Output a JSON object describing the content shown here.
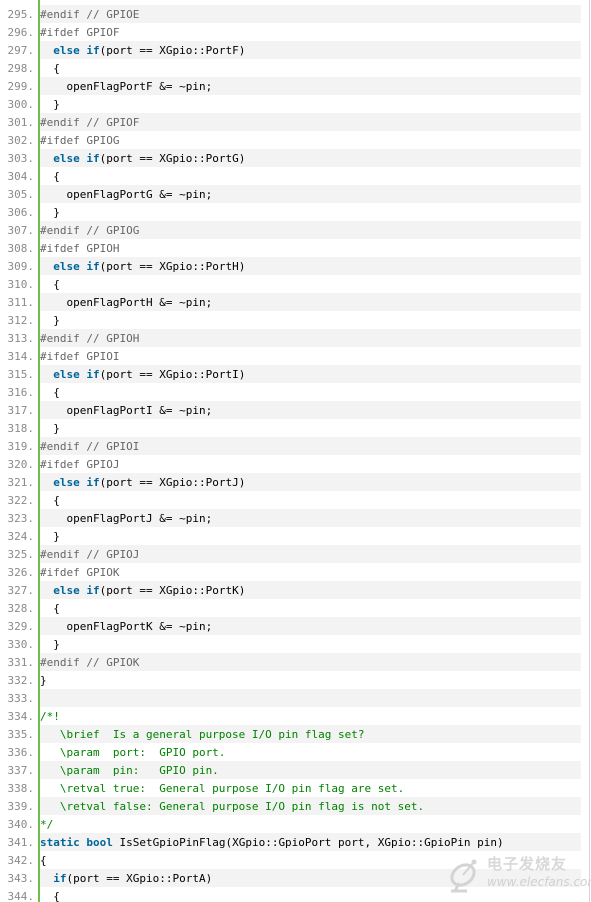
{
  "editor": {
    "lines": [
      {
        "n": "295.",
        "tokens": [
          [
            "preproc",
            "#endif // GPIOE"
          ]
        ]
      },
      {
        "n": "296.",
        "tokens": [
          [
            "preproc",
            "#ifdef GPIOF"
          ]
        ]
      },
      {
        "n": "297.",
        "tokens": [
          [
            "plain",
            "  "
          ],
          [
            "keyword",
            "else"
          ],
          [
            "plain",
            " "
          ],
          [
            "keyword",
            "if"
          ],
          [
            "plain",
            "(port == XGpio::PortF)"
          ]
        ]
      },
      {
        "n": "298.",
        "tokens": [
          [
            "plain",
            "  {"
          ]
        ]
      },
      {
        "n": "299.",
        "tokens": [
          [
            "plain",
            "    openFlagPortF &= ~pin;"
          ]
        ]
      },
      {
        "n": "300.",
        "tokens": [
          [
            "plain",
            "  }"
          ]
        ]
      },
      {
        "n": "301.",
        "tokens": [
          [
            "preproc",
            "#endif // GPIOF"
          ]
        ]
      },
      {
        "n": "302.",
        "tokens": [
          [
            "preproc",
            "#ifdef GPIOG"
          ]
        ]
      },
      {
        "n": "303.",
        "tokens": [
          [
            "plain",
            "  "
          ],
          [
            "keyword",
            "else"
          ],
          [
            "plain",
            " "
          ],
          [
            "keyword",
            "if"
          ],
          [
            "plain",
            "(port == XGpio::PortG)"
          ]
        ]
      },
      {
        "n": "304.",
        "tokens": [
          [
            "plain",
            "  {"
          ]
        ]
      },
      {
        "n": "305.",
        "tokens": [
          [
            "plain",
            "    openFlagPortG &= ~pin;"
          ]
        ]
      },
      {
        "n": "306.",
        "tokens": [
          [
            "plain",
            "  }"
          ]
        ]
      },
      {
        "n": "307.",
        "tokens": [
          [
            "preproc",
            "#endif // GPIOG"
          ]
        ]
      },
      {
        "n": "308.",
        "tokens": [
          [
            "preproc",
            "#ifdef GPIOH"
          ]
        ]
      },
      {
        "n": "309.",
        "tokens": [
          [
            "plain",
            "  "
          ],
          [
            "keyword",
            "else"
          ],
          [
            "plain",
            " "
          ],
          [
            "keyword",
            "if"
          ],
          [
            "plain",
            "(port == XGpio::PortH)"
          ]
        ]
      },
      {
        "n": "310.",
        "tokens": [
          [
            "plain",
            "  {"
          ]
        ]
      },
      {
        "n": "311.",
        "tokens": [
          [
            "plain",
            "    openFlagPortH &= ~pin;"
          ]
        ]
      },
      {
        "n": "312.",
        "tokens": [
          [
            "plain",
            "  }"
          ]
        ]
      },
      {
        "n": "313.",
        "tokens": [
          [
            "preproc",
            "#endif // GPIOH"
          ]
        ]
      },
      {
        "n": "314.",
        "tokens": [
          [
            "preproc",
            "#ifdef GPIOI"
          ]
        ]
      },
      {
        "n": "315.",
        "tokens": [
          [
            "plain",
            "  "
          ],
          [
            "keyword",
            "else"
          ],
          [
            "plain",
            " "
          ],
          [
            "keyword",
            "if"
          ],
          [
            "plain",
            "(port == XGpio::PortI)"
          ]
        ]
      },
      {
        "n": "316.",
        "tokens": [
          [
            "plain",
            "  {"
          ]
        ]
      },
      {
        "n": "317.",
        "tokens": [
          [
            "plain",
            "    openFlagPortI &= ~pin;"
          ]
        ]
      },
      {
        "n": "318.",
        "tokens": [
          [
            "plain",
            "  }"
          ]
        ]
      },
      {
        "n": "319.",
        "tokens": [
          [
            "preproc",
            "#endif // GPIOI"
          ]
        ]
      },
      {
        "n": "320.",
        "tokens": [
          [
            "preproc",
            "#ifdef GPIOJ"
          ]
        ]
      },
      {
        "n": "321.",
        "tokens": [
          [
            "plain",
            "  "
          ],
          [
            "keyword",
            "else"
          ],
          [
            "plain",
            " "
          ],
          [
            "keyword",
            "if"
          ],
          [
            "plain",
            "(port == XGpio::PortJ)"
          ]
        ]
      },
      {
        "n": "322.",
        "tokens": [
          [
            "plain",
            "  {"
          ]
        ]
      },
      {
        "n": "323.",
        "tokens": [
          [
            "plain",
            "    openFlagPortJ &= ~pin;"
          ]
        ]
      },
      {
        "n": "324.",
        "tokens": [
          [
            "plain",
            "  }"
          ]
        ]
      },
      {
        "n": "325.",
        "tokens": [
          [
            "preproc",
            "#endif // GPIOJ"
          ]
        ]
      },
      {
        "n": "326.",
        "tokens": [
          [
            "preproc",
            "#ifdef GPIOK"
          ]
        ]
      },
      {
        "n": "327.",
        "tokens": [
          [
            "plain",
            "  "
          ],
          [
            "keyword",
            "else"
          ],
          [
            "plain",
            " "
          ],
          [
            "keyword",
            "if"
          ],
          [
            "plain",
            "(port == XGpio::PortK)"
          ]
        ]
      },
      {
        "n": "328.",
        "tokens": [
          [
            "plain",
            "  {"
          ]
        ]
      },
      {
        "n": "329.",
        "tokens": [
          [
            "plain",
            "    openFlagPortK &= ~pin;"
          ]
        ]
      },
      {
        "n": "330.",
        "tokens": [
          [
            "plain",
            "  }"
          ]
        ]
      },
      {
        "n": "331.",
        "tokens": [
          [
            "preproc",
            "#endif // GPIOK"
          ]
        ]
      },
      {
        "n": "332.",
        "tokens": [
          [
            "plain",
            "}"
          ]
        ]
      },
      {
        "n": "333.",
        "tokens": []
      },
      {
        "n": "334.",
        "tokens": [
          [
            "comment",
            "/*!"
          ]
        ]
      },
      {
        "n": "335.",
        "tokens": [
          [
            "comment",
            "   \\brief  Is a general purpose I/O pin flag set?"
          ]
        ]
      },
      {
        "n": "336.",
        "tokens": [
          [
            "comment",
            "   \\param  port:  GPIO port."
          ]
        ]
      },
      {
        "n": "337.",
        "tokens": [
          [
            "comment",
            "   \\param  pin:   GPIO pin."
          ]
        ]
      },
      {
        "n": "338.",
        "tokens": [
          [
            "comment",
            "   \\retval true:  General purpose I/O pin flag are set."
          ]
        ]
      },
      {
        "n": "339.",
        "tokens": [
          [
            "comment",
            "   \\retval false: General purpose I/O pin flag is not set."
          ]
        ]
      },
      {
        "n": "340.",
        "tokens": [
          [
            "comment",
            "*/"
          ]
        ]
      },
      {
        "n": "341.",
        "tokens": [
          [
            "keyword",
            "static"
          ],
          [
            "plain",
            " "
          ],
          [
            "keyword",
            "bool"
          ],
          [
            "plain",
            " IsSetGpioPinFlag(XGpio::GpioPort port, XGpio::GpioPin pin)"
          ]
        ]
      },
      {
        "n": "342.",
        "tokens": [
          [
            "plain",
            "{"
          ]
        ]
      },
      {
        "n": "343.",
        "tokens": [
          [
            "plain",
            "  "
          ],
          [
            "keyword",
            "if"
          ],
          [
            "plain",
            "(port == XGpio::PortA)"
          ]
        ]
      },
      {
        "n": "344.",
        "tokens": [
          [
            "plain",
            "  {"
          ]
        ]
      }
    ]
  },
  "colors": {
    "keyword": "#006699",
    "preproc": "#666666",
    "comment": "#008200",
    "plain": "#000000",
    "line_number": "#8a8a8a",
    "gutter_bar": "#6fbf4f",
    "alt_row": "#f3f3f3"
  },
  "watermark": {
    "icon": "satellite-dish-icon",
    "text": "电子发烧友",
    "url": "www.elecfans.com"
  }
}
